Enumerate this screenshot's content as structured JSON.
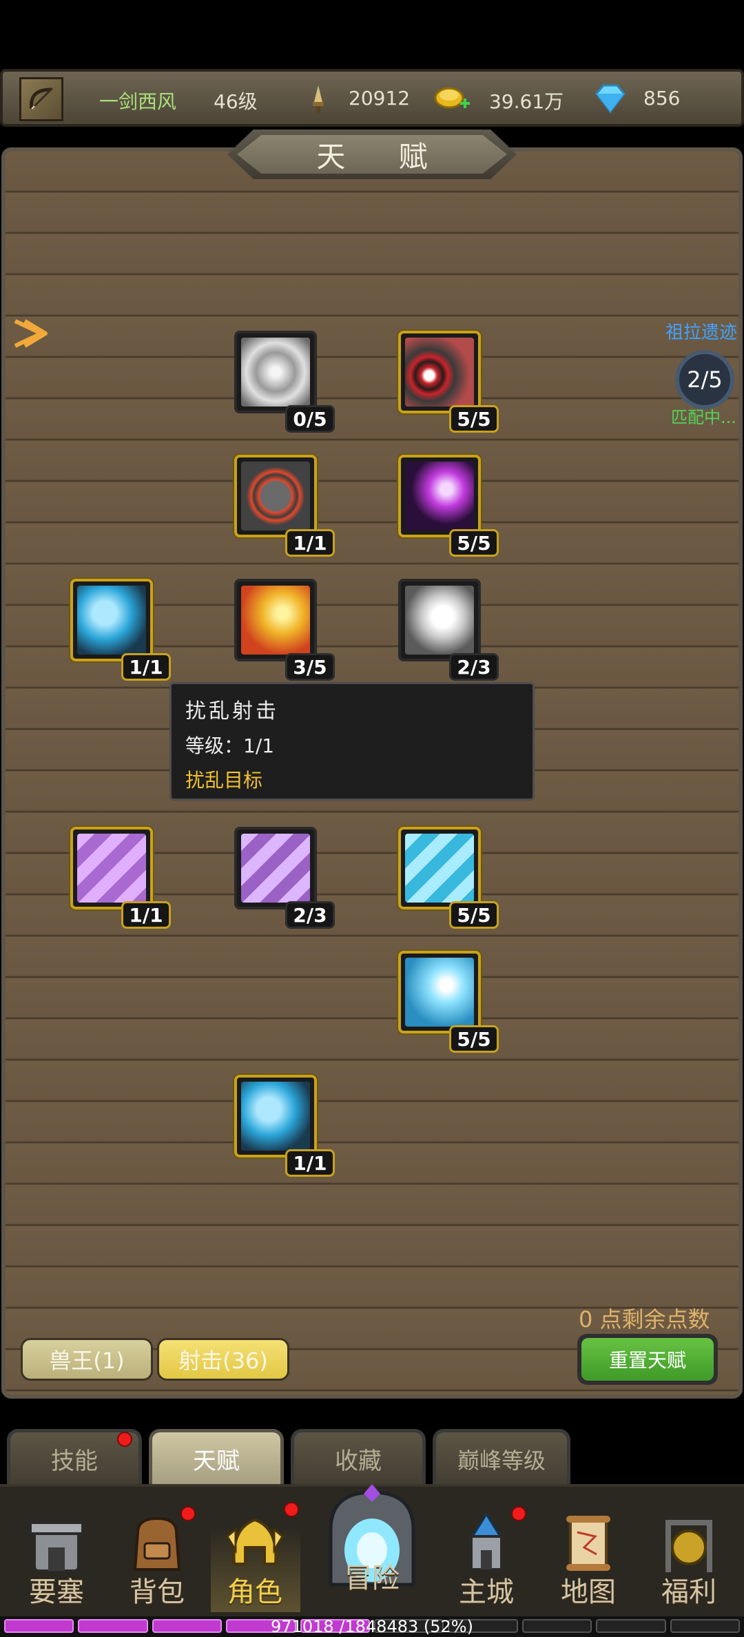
{
  "header": {
    "player_name": "一剑西风",
    "player_level": "46级",
    "attack": "20912",
    "gold": "39.61万",
    "gems": "856"
  },
  "panel": {
    "title": "天 赋"
  },
  "talents": [
    {
      "level": "0/5"
    },
    {
      "level": "5/5"
    },
    {
      "level": "1/1"
    },
    {
      "level": "5/5"
    },
    {
      "level": "1/1"
    },
    {
      "level": "3/5"
    },
    {
      "level": "2/3"
    },
    {
      "level": "1/1"
    },
    {
      "level": "2/3"
    },
    {
      "level": "5/5"
    },
    {
      "level": "5/5"
    },
    {
      "level": "1/1"
    }
  ],
  "tooltip": {
    "name": "扰乱射击",
    "level": "等级：1/1",
    "desc": "扰乱目标"
  },
  "side_event": {
    "title": "祖拉遗迹",
    "progress": "2/5",
    "status": "匹配中..."
  },
  "points_text": "0 点剩余点数",
  "tree_tabs": {
    "beast": "兽王(1)",
    "shoot": "射击(36)"
  },
  "reset_label": "重置天赋",
  "subtabs": [
    "技能",
    "天赋",
    "收藏",
    "巅峰等级"
  ],
  "nav": [
    "要塞",
    "背包",
    "角色",
    "冒险",
    "主城",
    "地图",
    "福利"
  ],
  "exp": {
    "text": "971018 /1848483 (52%)",
    "fraction": 0.52
  },
  "colors": {
    "gold_border": "#c9a21c",
    "reset_green": "#4fae2f",
    "tooltip_yellow": "#f2c230"
  }
}
